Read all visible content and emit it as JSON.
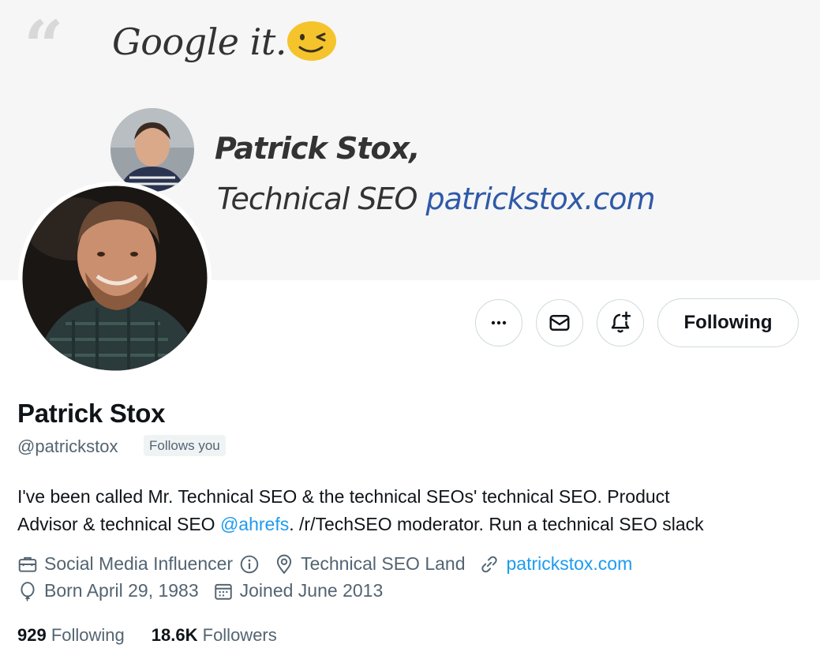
{
  "banner": {
    "quote_mark": "“",
    "tagline_google": "Google it.",
    "name": "Patrick Stox,",
    "title": "Technical SEO",
    "url": "patrickstox.com"
  },
  "actions": {
    "more_icon": "more-icon",
    "message_icon": "envelope-icon",
    "notify_icon": "bell-plus-icon",
    "following_label": "Following"
  },
  "profile": {
    "display_name": "Patrick Stox",
    "handle": "@patrickstox",
    "follows_you": "Follows you",
    "bio": {
      "line1": "I've been called Mr. Technical SEO & the technical SEOs' technical SEO. Product",
      "line2_prefix": "Advisor & technical SEO ",
      "line2_mention": "@ahrefs",
      "line2_suffix": ". /r/TechSEO moderator. Run a technical SEO slack"
    },
    "category": "Social Media Influencer",
    "location": "Technical SEO Land",
    "website": "patrickstox.com",
    "birthday": "Born April 29, 1983",
    "joined": "Joined June 2013"
  },
  "stats": {
    "following_count": "929",
    "following_label": "Following",
    "followers_count": "18.6K",
    "followers_label": "Followers"
  },
  "colors": {
    "accent": "#1d9bf0",
    "text_primary": "#0f1419",
    "text_secondary": "#536471",
    "border": "#cfd9de"
  }
}
